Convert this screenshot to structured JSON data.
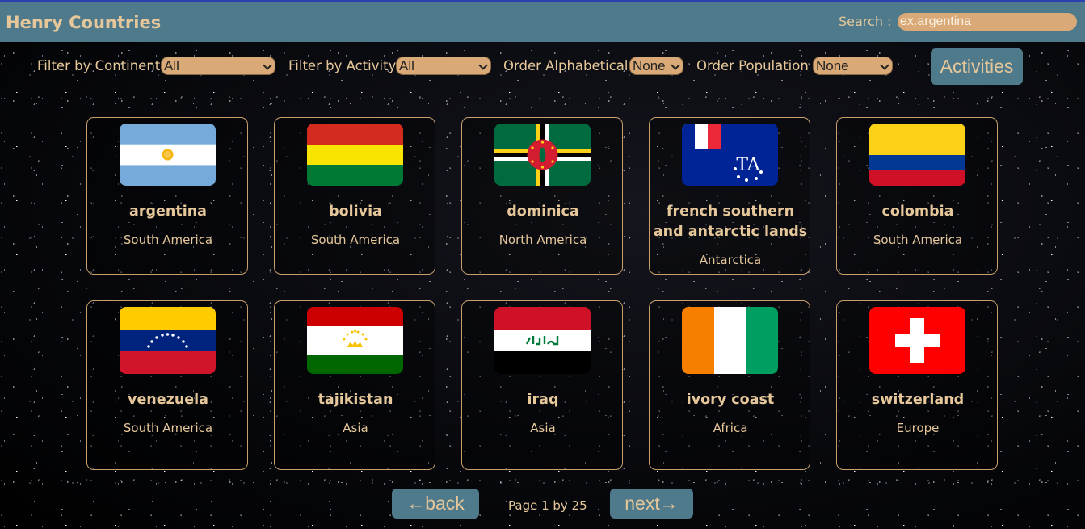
{
  "app": {
    "title": "Henry Countries"
  },
  "search": {
    "label": "Search :",
    "placeholder": "ex.argentina"
  },
  "filters": {
    "continent": {
      "label": "Filter by Continent",
      "value": "All"
    },
    "activity": {
      "label": "Filter by Activity",
      "value": "All"
    },
    "alphabetical": {
      "label": "Order Alphabetical",
      "value": "None"
    },
    "population": {
      "label": "Order Population",
      "value": "None"
    },
    "activities_button": "Activities"
  },
  "countries": [
    {
      "name": "argentina",
      "continent": "South America",
      "flag": "argentina-flag"
    },
    {
      "name": "bolivia",
      "continent": "South America",
      "flag": "bolivia-flag"
    },
    {
      "name": "dominica",
      "continent": "North America",
      "flag": "dominica-flag"
    },
    {
      "name": "french southern and antarctic lands",
      "continent": "Antarctica",
      "flag": "french-southern-lands-flag"
    },
    {
      "name": "colombia",
      "continent": "South America",
      "flag": "colombia-flag"
    },
    {
      "name": "venezuela",
      "continent": "South America",
      "flag": "venezuela-flag"
    },
    {
      "name": "tajikistan",
      "continent": "Asia",
      "flag": "tajikistan-flag"
    },
    {
      "name": "iraq",
      "continent": "Asia",
      "flag": "iraq-flag"
    },
    {
      "name": "ivory coast",
      "continent": "Africa",
      "flag": "ivory-coast-flag"
    },
    {
      "name": "switzerland",
      "continent": "Europe",
      "flag": "switzerland-flag"
    }
  ],
  "pagination": {
    "back_label": "←back",
    "next_label": "next→",
    "page_info": "Page 1 by 25"
  },
  "colors": {
    "header": "#4f7a8c",
    "accent_text": "#e6c79a",
    "select_bg": "#d9a977",
    "card_border": "#c9a06c"
  }
}
